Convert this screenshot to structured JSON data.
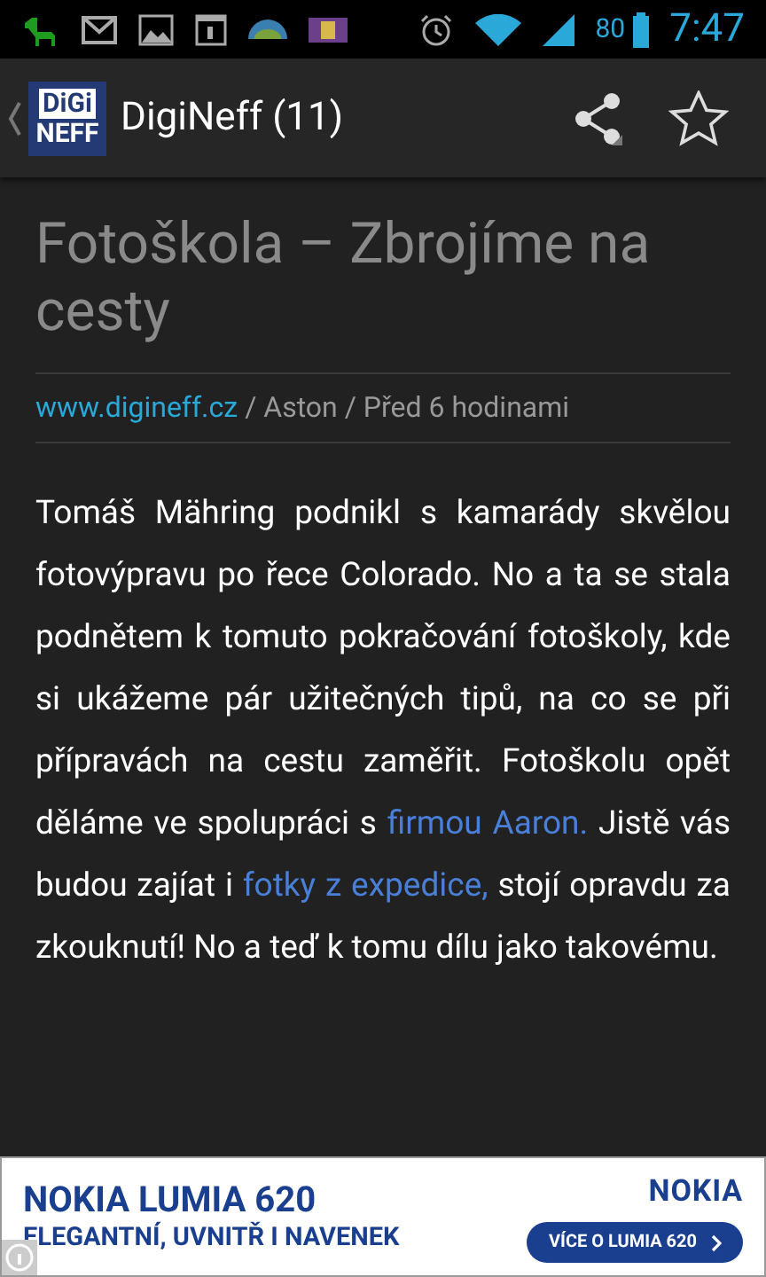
{
  "status_bar": {
    "battery": "80",
    "time": "7:47"
  },
  "action_bar": {
    "logo": [
      "DiGi",
      "NEFF"
    ],
    "title": "DigiNeff (11)"
  },
  "article": {
    "title": "Fotoškola – Zbrojíme na cesty",
    "source": "www.digineff.cz",
    "meta": " / Aston / Před 6 hodinami",
    "body": [
      {
        "kind": "text",
        "text": "Tomáš Mähring podnikl s kamarády skvělou fotovýpravu po řece Colorado. No a ta se stala podnětem k tomuto pokračování fotoškoly, kde si ukážeme pár užitečných tipů, na co se při přípravách na cestu zaměřit. Fotoškolu opět děláme ve spolupráci s "
      },
      {
        "kind": "link",
        "text": "firmou Aaron."
      },
      {
        "kind": "text",
        "text": " Jistě vás budou zajíat i "
      },
      {
        "kind": "link",
        "text": "fotky z expedice,"
      },
      {
        "kind": "text",
        "text": " stojí opravdu za zkouknutí! No a teď k tomu dílu jako takovému."
      }
    ]
  },
  "ad": {
    "headline": "NOKIA LUMIA 620",
    "tagline": "ELEGANTNÍ, UVNITŘ I NAVENEK",
    "brand": "NOKIA",
    "cta": "VÍCE O LUMIA 620"
  }
}
